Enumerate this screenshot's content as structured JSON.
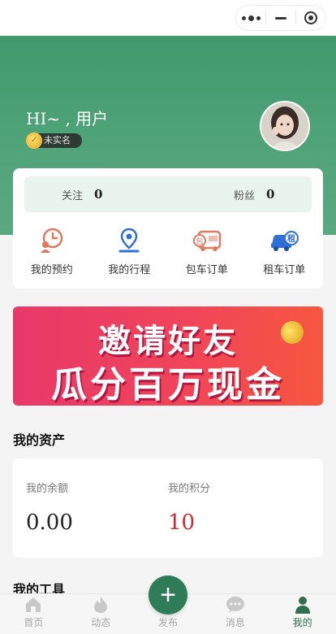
{
  "header": {
    "greeting": "HI~ , 用户",
    "verify_status": "未实名"
  },
  "stats": {
    "follow_label": "关注",
    "follow_count": "0",
    "fans_label": "粉丝",
    "fans_count": "0"
  },
  "quick_actions": [
    {
      "label": "我的预约",
      "icon": "clock-person-icon"
    },
    {
      "label": "我的行程",
      "icon": "map-pin-icon"
    },
    {
      "label": "包车订单",
      "icon": "bus-icon"
    },
    {
      "label": "租车订单",
      "icon": "rental-car-icon"
    }
  ],
  "banner": {
    "line1": "邀请好友",
    "line2": "瓜分百万现金"
  },
  "assets": {
    "title": "我的资产",
    "balance_label": "我的余额",
    "balance_value": "0.00",
    "points_label": "我的积分",
    "points_value": "10"
  },
  "tools": {
    "title": "我的工具"
  },
  "tabbar": {
    "items": [
      {
        "label": "首页",
        "icon": "home-icon"
      },
      {
        "label": "动态",
        "icon": "flame-icon"
      },
      {
        "label": "发布",
        "icon": "plus-icon"
      },
      {
        "label": "消息",
        "icon": "chat-icon"
      },
      {
        "label": "我的",
        "icon": "user-icon"
      }
    ],
    "active": "我的"
  },
  "colors": {
    "brand_green": "#3f9a6c",
    "tab_active": "#2f6f4d",
    "points_red": "#d12a2a",
    "banner_pink": "#e8386a"
  }
}
